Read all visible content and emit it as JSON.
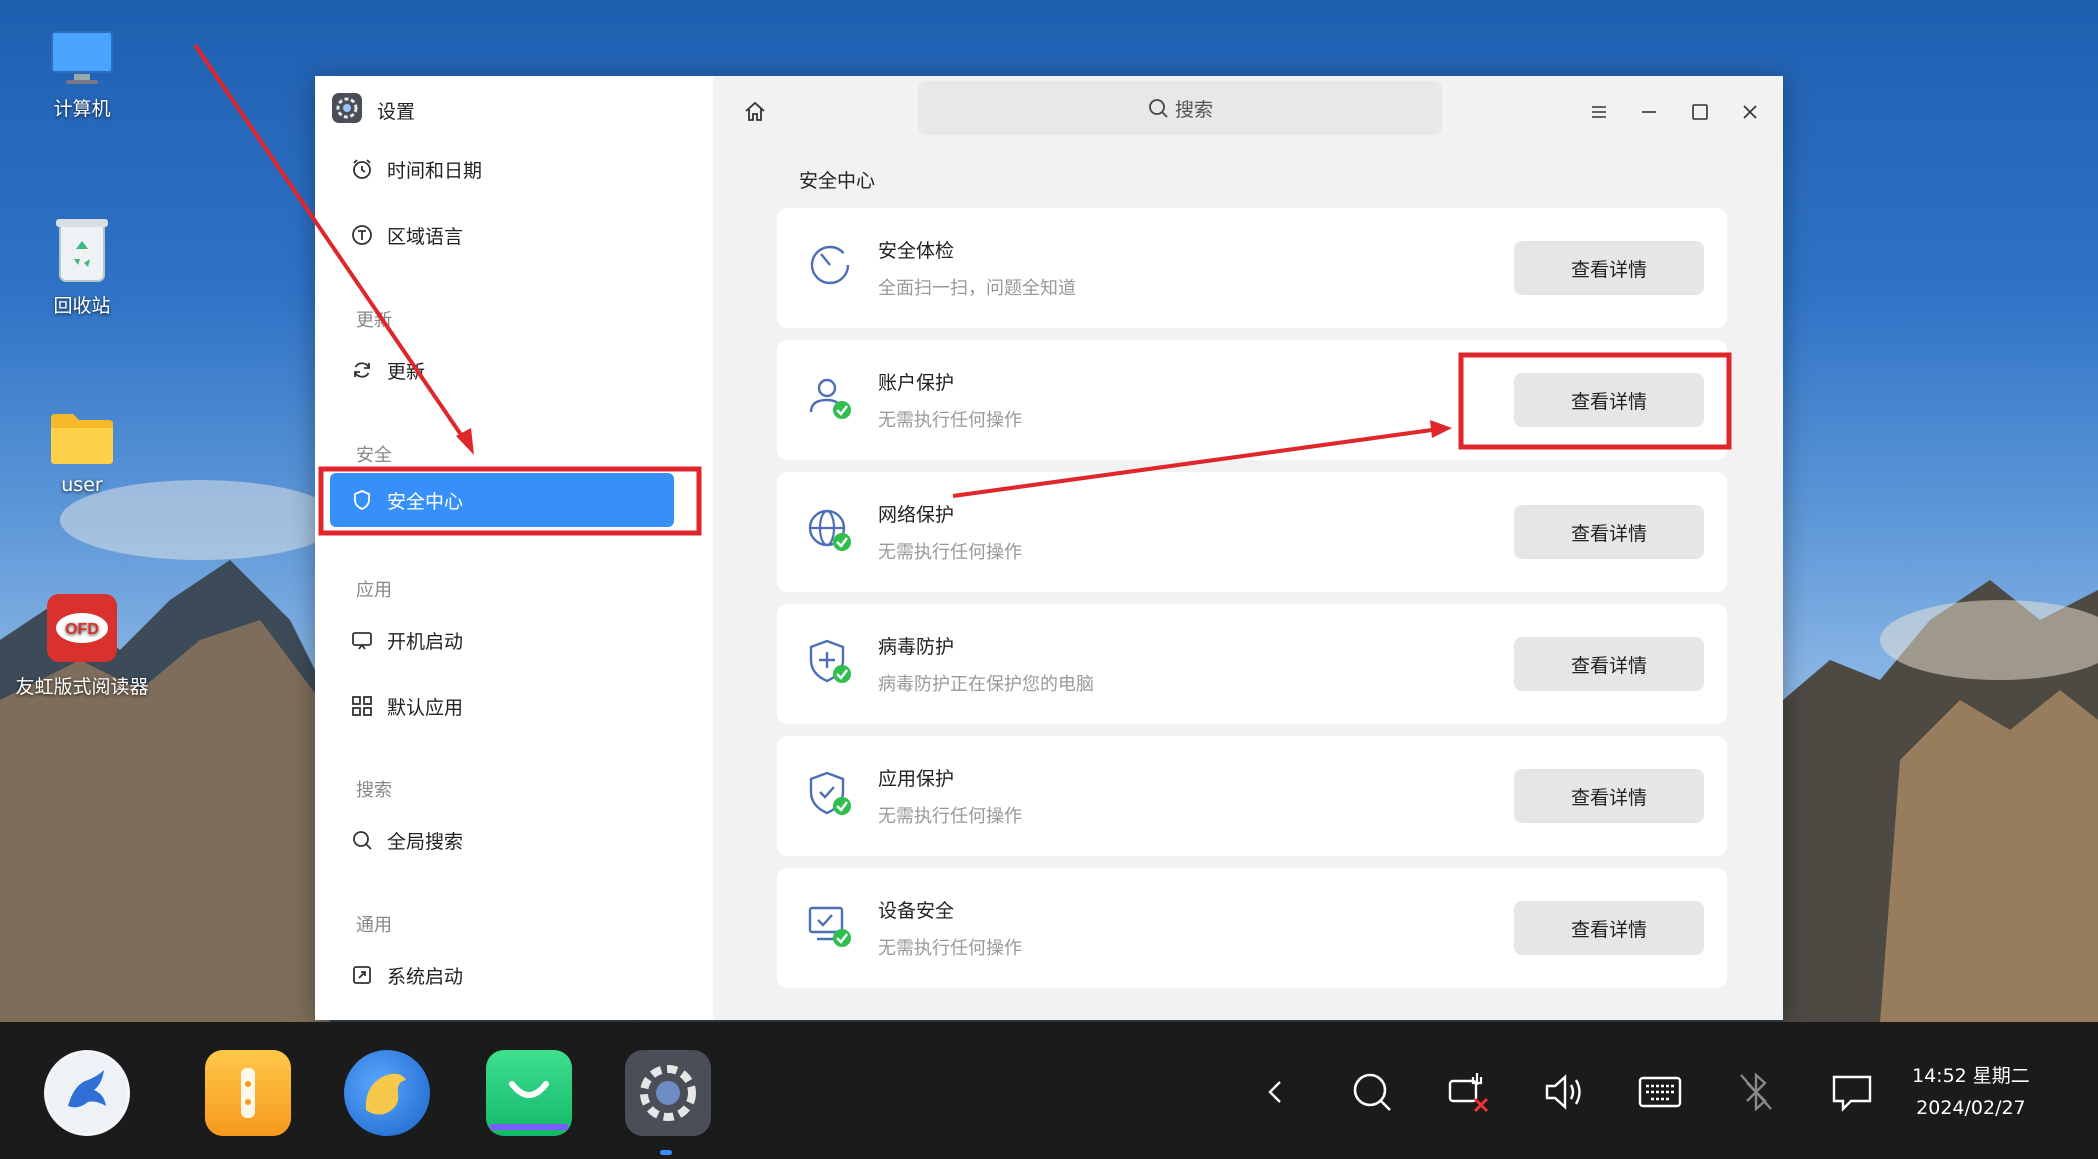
{
  "desktop": {
    "icons": [
      {
        "label": "计算机",
        "icon": "computer-icon"
      },
      {
        "label": "回收站",
        "icon": "recycle-bin-icon"
      },
      {
        "label": "user",
        "icon": "folder-icon"
      },
      {
        "label": "友虹版式阅读器",
        "icon": "ofd-reader-icon"
      }
    ]
  },
  "window": {
    "title": "设置",
    "search_placeholder": "搜索",
    "sidebar": {
      "items": [
        {
          "label": "时间和日期",
          "icon": "clock-icon"
        },
        {
          "label": "区域语言",
          "icon": "language-icon"
        },
        {
          "group": "更新"
        },
        {
          "label": "更新",
          "icon": "refresh-icon"
        },
        {
          "group": "安全"
        },
        {
          "label": "安全中心",
          "icon": "shield-icon",
          "active": true
        },
        {
          "group": "应用"
        },
        {
          "label": "开机启动",
          "icon": "startup-icon"
        },
        {
          "label": "默认应用",
          "icon": "grid-icon"
        },
        {
          "group": "搜索"
        },
        {
          "label": "全局搜索",
          "icon": "search-icon"
        },
        {
          "group": "通用"
        },
        {
          "label": "系统启动",
          "icon": "system-boot-icon"
        }
      ]
    },
    "main": {
      "section_title": "安全中心",
      "button_label": "查看详情",
      "cards": [
        {
          "title": "安全体检",
          "subtitle": "全面扫一扫，问题全知道",
          "icon": "scan-icon"
        },
        {
          "title": "账户保护",
          "subtitle": "无需执行任何操作",
          "icon": "account-protect-icon"
        },
        {
          "title": "网络保护",
          "subtitle": "无需执行任何操作",
          "icon": "network-protect-icon"
        },
        {
          "title": "病毒防护",
          "subtitle": "病毒防护正在保护您的电脑",
          "icon": "virus-protect-icon"
        },
        {
          "title": "应用保护",
          "subtitle": "无需执行任何操作",
          "icon": "app-protect-icon"
        },
        {
          "title": "设备安全",
          "subtitle": "无需执行任何操作",
          "icon": "device-security-icon"
        }
      ]
    }
  },
  "taskbar": {
    "apps": [
      "start-menu-icon",
      "file-manager-icon",
      "browser-icon",
      "app-store-icon",
      "settings-icon"
    ],
    "tray": [
      "back-icon",
      "search-icon",
      "network-disconnected-icon",
      "volume-icon",
      "keyboard-icon",
      "bluetooth-off-icon",
      "notification-icon"
    ],
    "time": "14:52 星期二",
    "date": "2024/02/27"
  },
  "colors": {
    "accent": "#3790fa",
    "annotation": "#e0262b",
    "success": "#2fbf4f"
  }
}
